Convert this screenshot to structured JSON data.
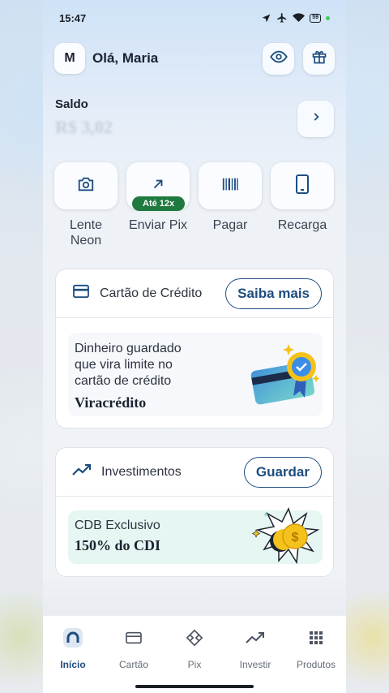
{
  "status": {
    "time": "15:47",
    "battery": "59"
  },
  "header": {
    "avatar_initial": "M",
    "greeting": "Olá, Maria"
  },
  "balance": {
    "label": "Saldo",
    "value": "R$ 3,02"
  },
  "actions": [
    {
      "label": "Lente Neon",
      "icon": "camera-icon"
    },
    {
      "label": "Enviar Pix",
      "icon": "arrow-up-right-icon",
      "badge": "Até 12x"
    },
    {
      "label": "Pagar",
      "icon": "barcode-icon"
    },
    {
      "label": "Recarga",
      "icon": "phone-icon"
    }
  ],
  "credit_card": {
    "title": "Cartão de Crédito",
    "button": "Saiba mais",
    "promo_lines": [
      "Dinheiro guardado",
      "que vira limite no",
      "cartão de crédito"
    ],
    "promo_title": "Viracrédito"
  },
  "investments": {
    "title": "Investimentos",
    "button": "Guardar",
    "promo_line": "CDB Exclusivo",
    "promo_title": "150% do CDI"
  },
  "nav": [
    {
      "label": "Início",
      "icon": "home-icon",
      "active": true
    },
    {
      "label": "Cartão",
      "icon": "card-icon"
    },
    {
      "label": "Pix",
      "icon": "pix-icon"
    },
    {
      "label": "Investir",
      "icon": "trend-icon"
    },
    {
      "label": "Produtos",
      "icon": "grid-icon"
    }
  ],
  "colors": {
    "accent": "#1e4d80",
    "badge": "#1f7a3f"
  }
}
